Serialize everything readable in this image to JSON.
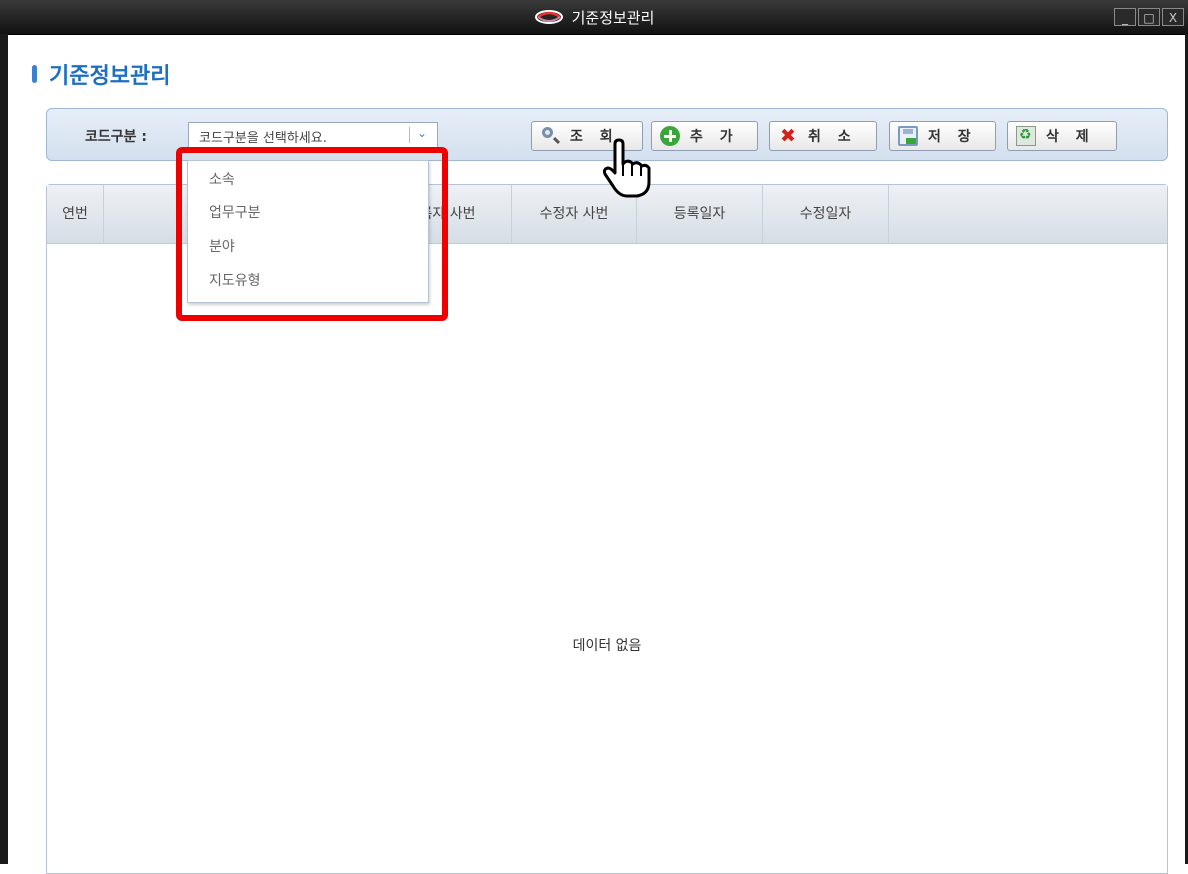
{
  "window": {
    "title": "기준정보관리",
    "controls": [
      "_",
      "□",
      "X"
    ]
  },
  "page": {
    "title": "기준정보관리"
  },
  "toolbar": {
    "code_label": "코드구분 :",
    "code_select_value": "코드구분을 선택하세요.",
    "buttons": {
      "search": "조 회",
      "add": "추 가",
      "cancel": "취 소",
      "save": "저 장",
      "delete": "삭 제"
    }
  },
  "dropdown": {
    "options": [
      "소속",
      "업무구분",
      "분야",
      "지도유형"
    ]
  },
  "grid": {
    "columns": [
      "연번",
      "",
      "",
      "록자 사번",
      "수정자 사번",
      "등록일자",
      "수정일자"
    ],
    "empty_message": "데이터 없음"
  },
  "colors": {
    "accent": "#1e6fc4",
    "highlight": "#ee0000",
    "toolbar_bg": "#dde7f3"
  },
  "icons": [
    "app-logo-icon",
    "search-icon",
    "add-icon",
    "cancel-icon",
    "save-icon",
    "delete-icon",
    "chevron-down-icon",
    "hand-cursor-icon"
  ]
}
